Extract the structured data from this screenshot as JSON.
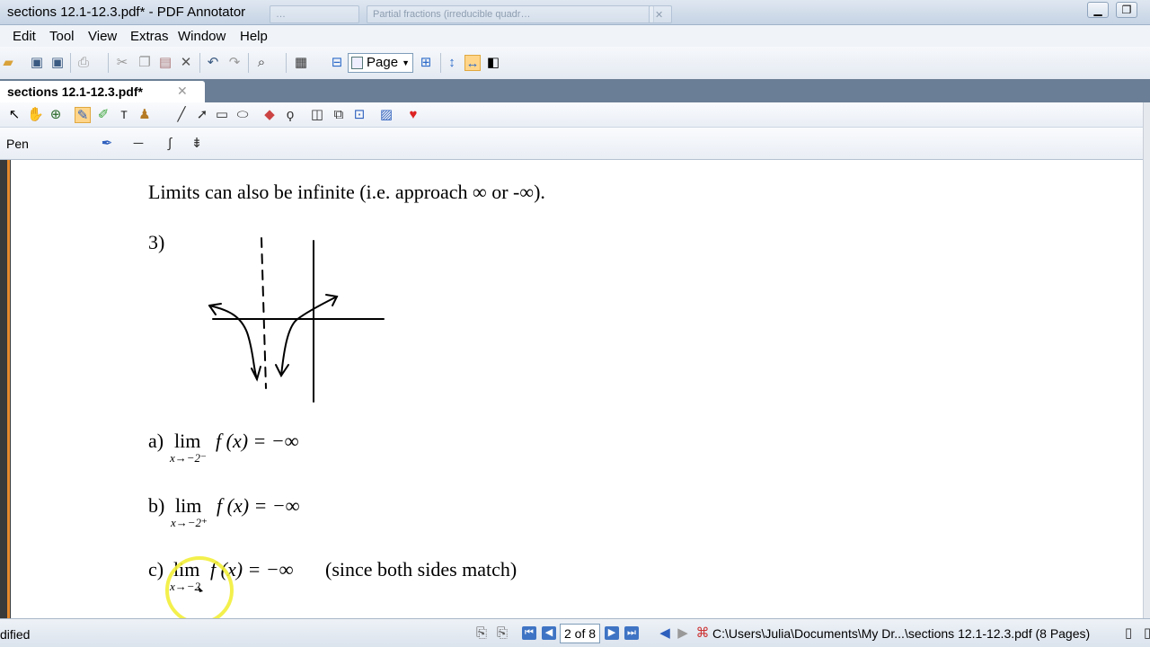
{
  "window": {
    "title": "sections 12.1-12.3.pdf* - PDF Annotator",
    "ghost_tab_1": "…",
    "ghost_tab_2": "Partial fractions (irreducible quadr…",
    "min": "▁",
    "max": "❐",
    "close": "✕"
  },
  "menu": {
    "edit": "Edit",
    "tool": "Tool",
    "view": "View",
    "extras": "Extras",
    "window": "Window",
    "help": "Help"
  },
  "toolbar": {
    "page_mode": "Page"
  },
  "tab": {
    "label": "sections 12.1-12.3.pdf*",
    "close": "✕"
  },
  "pen_bar": {
    "label": "Pen"
  },
  "document": {
    "heading": "Limits can also be infinite (i.e. approach ∞ or -∞).",
    "problem_number": "3)",
    "a": {
      "prefix": "a)",
      "lim": "lim",
      "sub": "x→−2⁻",
      "expr": "f (x) = −∞"
    },
    "b": {
      "prefix": "b)",
      "lim": "lim",
      "sub": "x→−2⁺",
      "expr": "f (x) = −∞"
    },
    "c": {
      "prefix": "c)",
      "lim": "lim",
      "sub": "x→−2",
      "expr": "f (x) = −∞",
      "note": "(since both sides match)"
    }
  },
  "status": {
    "left_text": "dified",
    "page_field": "2 of 8",
    "file_path": "C:\\Users\\Julia\\Documents\\My Dr...\\sections 12.1-12.3.pdf (8 Pages)"
  },
  "colors": {
    "accent_orange": "#e6892c",
    "tab_strip": "#6a7e95",
    "cursor_highlight": "#f2ee3a"
  }
}
